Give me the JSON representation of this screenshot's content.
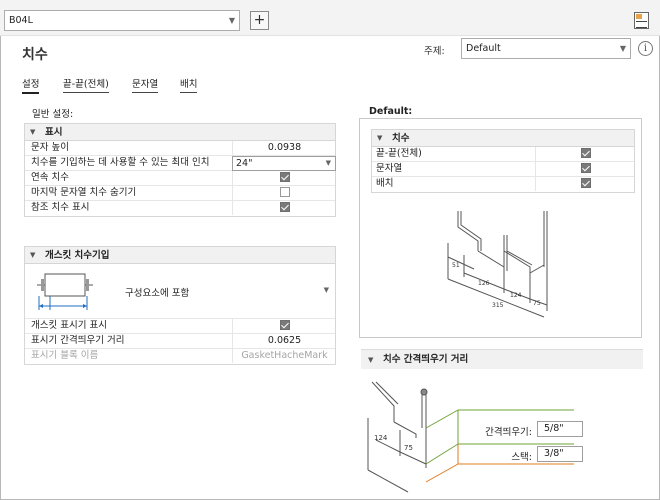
{
  "toolbar": {
    "drawing_combo_value": "B04L",
    "plus_label": "+"
  },
  "header": {
    "title": "치수",
    "topic_label": "주제:",
    "topic_value": "Default",
    "info_label": "i"
  },
  "tabs": [
    {
      "label": "설정",
      "active": true
    },
    {
      "label": "끝-끝(전체)",
      "active": false
    },
    {
      "label": "문자열",
      "active": false
    },
    {
      "label": "배치",
      "active": false
    }
  ],
  "general_settings": {
    "heading": "일반 설정:",
    "display_group": {
      "title": "표시",
      "rows": [
        {
          "label": "문자 높이",
          "value": "0.0938"
        },
        {
          "label": "치수를 기입하는 데 사용할 수 있는 최대 인치",
          "value": "24\""
        },
        {
          "label": "연속 치수",
          "checked": true
        },
        {
          "label": "마지막 문자열 치수 숨기기",
          "checked": false
        },
        {
          "label": "참조 치수 표시",
          "checked": true
        }
      ]
    },
    "gasket_group": {
      "title": "개스킷 치수기입",
      "option_label": "구성요소에 포함",
      "rows": [
        {
          "label": "개스킷 표시기 표시",
          "checked": true
        },
        {
          "label": "표시기 간격띄우기 거리",
          "value": "0.0625"
        },
        {
          "label": "표시기 블록 이름",
          "value": "GasketHacheMark"
        }
      ]
    }
  },
  "default_panel": {
    "heading": "Default:",
    "group_title": "치수",
    "rows": [
      {
        "label": "끝-끝(전체)",
        "checked": true
      },
      {
        "label": "문자열",
        "checked": true
      },
      {
        "label": "배치",
        "checked": true
      }
    ],
    "preview_labels": [
      "51",
      "126",
      "124",
      "75",
      "315"
    ]
  },
  "spacing_panel": {
    "title": "치수 간격띄우기 거리",
    "offset_label": "간격띄우기:",
    "offset_value": "5/8\"",
    "stack_label": "스택:",
    "stack_value": "3/8\"",
    "preview_labels": [
      "124",
      "75"
    ]
  },
  "colors": {
    "offset_line": "#6fa336",
    "stack_line": "#e07b1f",
    "grid_header_bg": "#f1f1f1"
  }
}
